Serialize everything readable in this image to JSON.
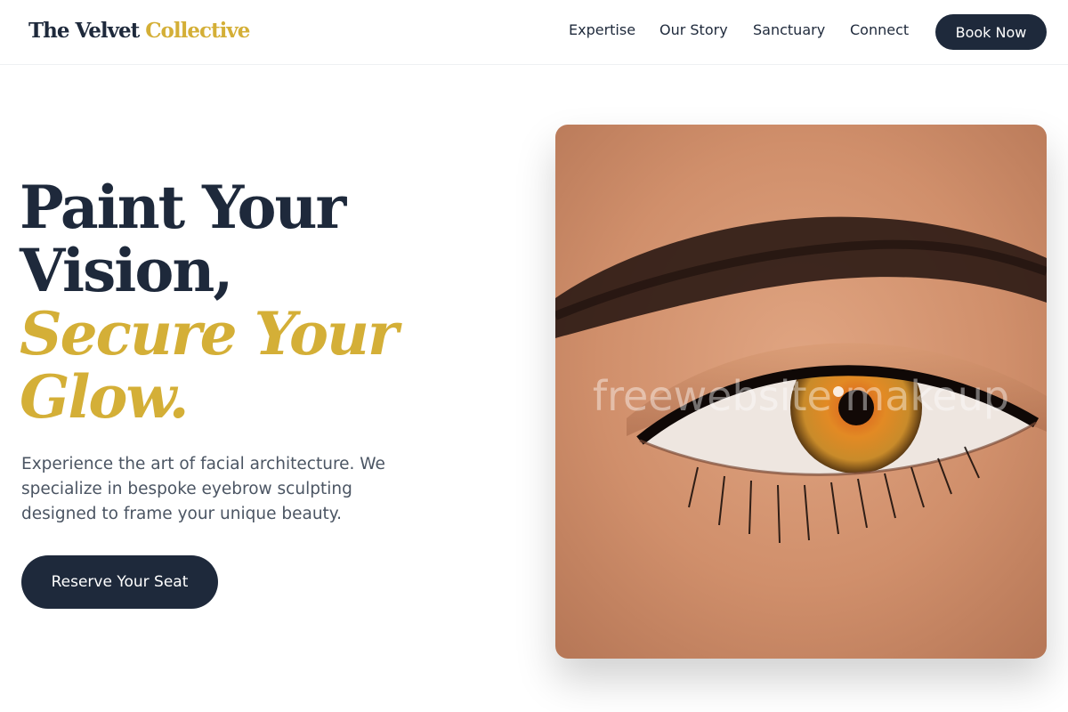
{
  "brand": {
    "name_part1": "The Velvet",
    "name_part2": "Collective",
    "accent_color": "#d4af37",
    "dark_color": "#1e293b"
  },
  "nav": {
    "items": [
      {
        "label": "Expertise"
      },
      {
        "label": "Our Story"
      },
      {
        "label": "Sanctuary"
      },
      {
        "label": "Connect"
      }
    ],
    "cta_label": "Book Now"
  },
  "hero": {
    "title_line1": "Paint Your",
    "title_line2": "Vision,",
    "title_line3": "Secure Your",
    "title_line4": "Glow.",
    "description": "Experience the art of facial architecture. We specialize in bespoke eyebrow sculpting designed to frame your unique beauty.",
    "cta_label": "Reserve Your Seat",
    "image_watermark": "freewebsite makeup"
  }
}
